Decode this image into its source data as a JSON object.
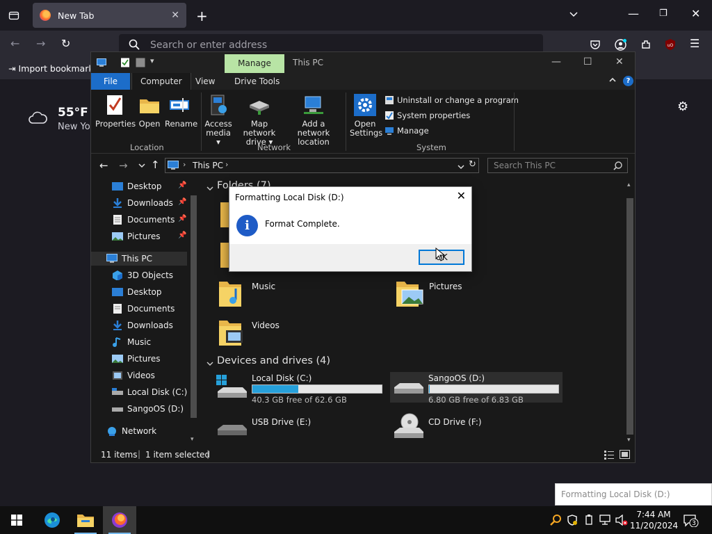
{
  "browser": {
    "tab_title": "New Tab",
    "url_placeholder": "Search or enter address",
    "import_bookmarks": "Import bookmarks",
    "weather_temp": "55°F",
    "weather_location": "New Yo"
  },
  "explorer": {
    "window_title": "This PC",
    "context_tab": "Manage",
    "ribbon_tabs": [
      "File",
      "Computer",
      "View",
      "Drive Tools"
    ],
    "ribbon": {
      "location": {
        "label": "Location",
        "buttons": [
          "Properties",
          "Open",
          "Rename"
        ]
      },
      "network": {
        "label": "Network",
        "access_media": [
          "Access",
          "media ▾"
        ],
        "map_drive": [
          "Map network",
          "drive ▾"
        ],
        "add_location": [
          "Add a network",
          "location"
        ]
      },
      "system": {
        "label": "System",
        "open_settings": [
          "Open",
          "Settings"
        ],
        "items": [
          "Uninstall or change a program",
          "System properties",
          "Manage"
        ]
      }
    },
    "address": {
      "path": "This PC",
      "search_placeholder": "Search This PC"
    },
    "nav": {
      "quick": [
        "Desktop",
        "Downloads",
        "Documents",
        "Pictures"
      ],
      "this_pc": "This PC",
      "pc_items": [
        "3D Objects",
        "Desktop",
        "Documents",
        "Downloads",
        "Music",
        "Pictures",
        "Videos",
        "Local Disk (C:)",
        "SangoOS (D:)"
      ],
      "network": "Network"
    },
    "content": {
      "folders_header": "Folders (7)",
      "folders": [
        "Music",
        "Pictures",
        "Videos"
      ],
      "devices_header": "Devices and drives (4)",
      "drives": [
        {
          "name": "Local Disk (C:)",
          "free": "40.3 GB free of 62.6 GB",
          "used_fraction": 0.356
        },
        {
          "name": "SangoOS (D:)",
          "free": "6.80 GB free of 6.83 GB",
          "used_fraction": 0.004
        },
        {
          "name": "USB Drive (E:)"
        },
        {
          "name": "CD Drive (F:)"
        }
      ]
    },
    "status": {
      "items": "11 items",
      "selected": "1 item selected"
    }
  },
  "dialog": {
    "title": "Formatting Local Disk (D:)",
    "message": "Format Complete.",
    "ok": "OK",
    "info_glyph": "i"
  },
  "toast": {
    "text": "Formatting Local Disk (D:)"
  },
  "taskbar": {
    "time": "7:44 AM",
    "date": "11/20/2024",
    "notifications": "3"
  },
  "colors": {
    "accent": "#1c6dc9",
    "manage": "#b8e4a5",
    "drive_fill": "#26a0da"
  }
}
